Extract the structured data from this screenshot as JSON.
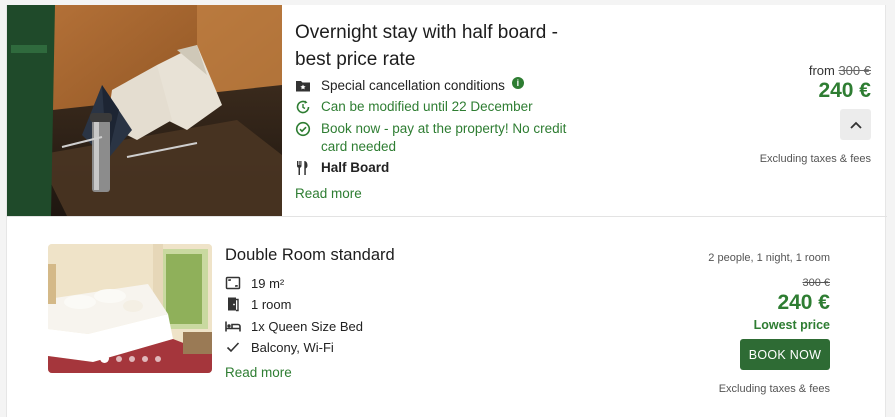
{
  "rate": {
    "title_line1": "Overnight stay with half board -",
    "title_line2": "best price rate",
    "features": [
      {
        "icon": "folder-star-icon",
        "label": "Special cancellation conditions",
        "info_icon": "info-icon"
      },
      {
        "icon": "calendar-refresh-icon",
        "label": "Can be modified until 22 December"
      },
      {
        "icon": "check-circle-icon",
        "label": "Book now - pay at the property! No credit card needed"
      },
      {
        "icon": "fork-knife-icon",
        "label": "Half Board"
      }
    ],
    "read_more": "Read more",
    "from_label": "from",
    "old_price": "300 €",
    "price": "240 €",
    "toggle_icon": "chevron-up-icon",
    "tax_note": "Excluding taxes & fees"
  },
  "room": {
    "title": "Double Room standard",
    "occupancy": "2 people, 1 night, 1 room",
    "features": [
      {
        "icon": "area-icon",
        "label": "19 m²"
      },
      {
        "icon": "door-icon",
        "label": "1 room"
      },
      {
        "icon": "bed-icon",
        "label": "1x Queen Size Bed"
      },
      {
        "icon": "check-icon",
        "label": "Balcony, Wi-Fi"
      }
    ],
    "read_more": "Read more",
    "old_price": "300 €",
    "price": "240 €",
    "price_badge": "Lowest price",
    "book_label": "BOOK NOW",
    "tax_note": "Excluding taxes & fees",
    "gallery_count": 5,
    "gallery_active": 1
  },
  "colors": {
    "accent_green": "#2e7d32",
    "button_green": "#2e6b34"
  }
}
